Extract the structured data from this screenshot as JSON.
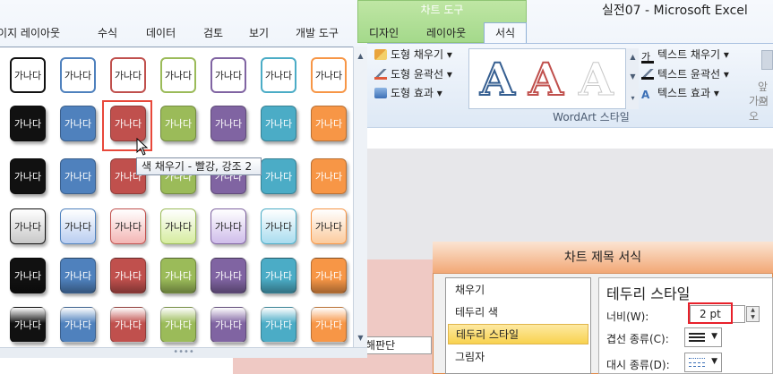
{
  "window": {
    "title": "실전07 - Microsoft Excel"
  },
  "tabs": [
    {
      "label": "페이지 레이아웃"
    },
    {
      "label": "수식"
    },
    {
      "label": "데이터"
    },
    {
      "label": "검토"
    },
    {
      "label": "보기"
    },
    {
      "label": "개발 도구"
    },
    {
      "label": "디자인"
    },
    {
      "label": "레이아웃"
    },
    {
      "label": "서식"
    }
  ],
  "contextual_group": {
    "title": "차트 도구"
  },
  "shape_commands": {
    "fill": "도형 채우기",
    "outline": "도형 윤곽선",
    "effects": "도형 효과"
  },
  "wordart": {
    "group_label": "WordArt 스타일",
    "fill": "텍스트 채우기",
    "outline": "텍스트 윤곽선",
    "effects": "텍스트 효과",
    "samples": [
      "A",
      "A",
      "A"
    ]
  },
  "arrange_fragment": {
    "line1": "앞으",
    "line2": "가져오"
  },
  "gallery": {
    "sample_text": "가나다",
    "theme_colors": [
      "#111111",
      "#4f81bd",
      "#c0504d",
      "#9bbb59",
      "#8064a2",
      "#4bacc6",
      "#f79646"
    ],
    "pale_colors": [
      "#c8c8c8",
      "#b9cdf0",
      "#f3b6b4",
      "#d6ec9f",
      "#cfbdea",
      "#a9dcef",
      "#fbcb9d"
    ],
    "selected": {
      "row": 2,
      "col": 3
    }
  },
  "tooltip": "색 채우기 - 빨강, 강조 2",
  "cell_fragment": "이해판단",
  "dialog": {
    "title": "차트 제목 서식",
    "categories": [
      "채우기",
      "테두리 색",
      "테두리 스타일",
      "그림자"
    ],
    "selected_category": "테두리 스타일",
    "heading": "테두리 스타일",
    "width_label": "너비(W):",
    "width_value": "2 pt",
    "compound_label": "겹선 종류(C):",
    "dash_label": "대시 종류(D):"
  }
}
